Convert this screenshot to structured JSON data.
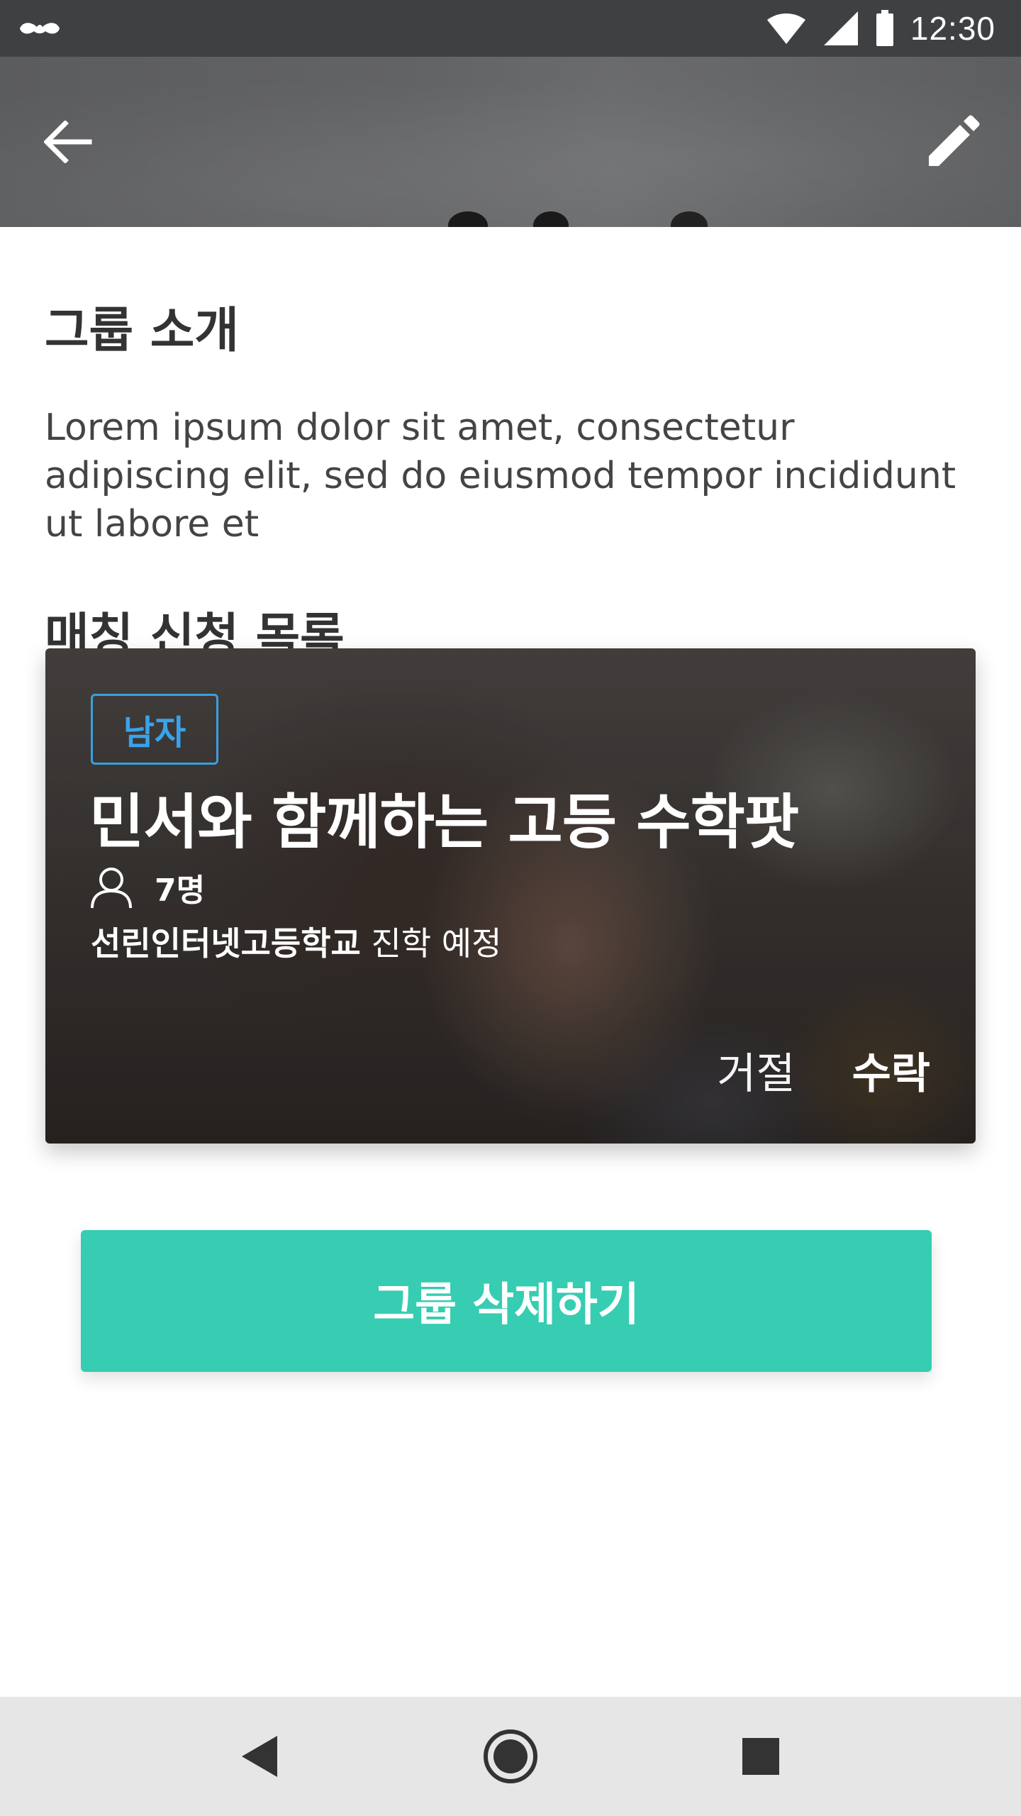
{
  "status_bar": {
    "time": "12:30",
    "icons": [
      "mustache-icon",
      "wifi-icon",
      "signal-icon",
      "battery-icon"
    ]
  },
  "header": {
    "back_icon": "arrow-back-icon",
    "edit_icon": "pencil-icon"
  },
  "intro": {
    "title": "그룹 소개",
    "text": "Lorem ipsum dolor sit amet, consectetur adipiscing elit, sed do eiusmod tempor incididunt ut labore et"
  },
  "matching": {
    "title": "매칭 신청 목록",
    "card": {
      "gender": "남자",
      "title": "민서와 함께하는 고등 수학팟",
      "member_count": "7명",
      "school_name": "선린인터넷고등학교",
      "school_suffix": " 진학 예정",
      "reject_label": "거절",
      "accept_label": "수락"
    }
  },
  "actions": {
    "delete_label": "그룹 삭제하기"
  },
  "colors": {
    "accent": "#36cdb2",
    "badge": "#3aa2ea",
    "status_bar": "#3f4042",
    "nav_bar": "#e6e6e6"
  }
}
